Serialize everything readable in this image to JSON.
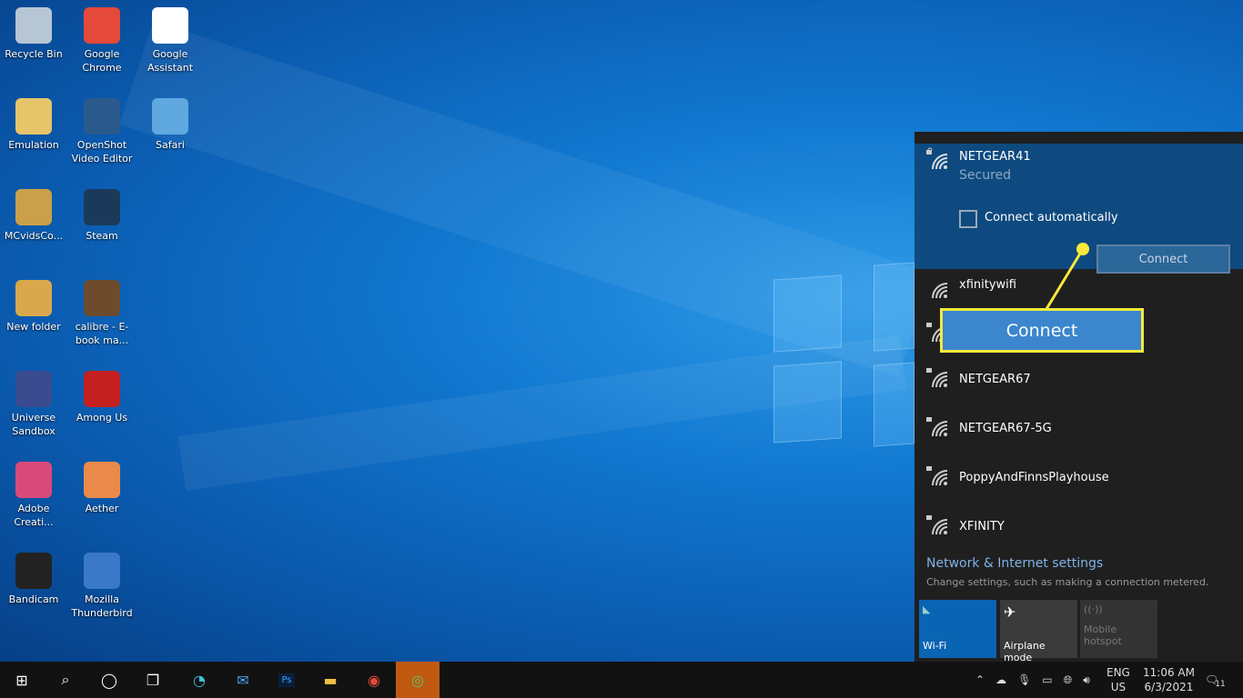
{
  "desktop_icons": [
    {
      "label": "Recycle Bin",
      "color": "#b7c6d4"
    },
    {
      "label": "Google Chrome",
      "color": "#e4493a"
    },
    {
      "label": "Google Assistant",
      "color": "#ffffff"
    },
    {
      "label": "Emulation",
      "color": "#e6c46a"
    },
    {
      "label": "OpenShot Video Editor",
      "color": "#2a5a8c"
    },
    {
      "label": "Safari",
      "color": "#5fa8e0"
    },
    {
      "label": "MCvidsCo...",
      "color": "#caa04a"
    },
    {
      "label": "Steam",
      "color": "#1b3a5a"
    },
    {
      "label": "New folder",
      "color": "#d9a84c"
    },
    {
      "label": "calibre - E-book ma...",
      "color": "#6d4c2e"
    },
    {
      "label": "Universe Sandbox",
      "color": "#3b4b8f"
    },
    {
      "label": "Among Us",
      "color": "#c42020"
    },
    {
      "label": "Adobe Creati...",
      "color": "#d84a7a"
    },
    {
      "label": "Aether",
      "color": "#e98a4a"
    },
    {
      "label": "Bandicam",
      "color": "#222222"
    },
    {
      "label": "Mozilla Thunderbird",
      "color": "#3a78c8"
    }
  ],
  "network_panel": {
    "selected": {
      "name": "NETGEAR41",
      "status": "Secured",
      "auto_label": "Connect automatically",
      "auto_checked": false,
      "connect_label": "Connect"
    },
    "networks": [
      {
        "name": "xfinitywifi",
        "secured": false
      },
      {
        "name": "",
        "secured": true
      },
      {
        "name": "NETGEAR67",
        "secured": true
      },
      {
        "name": "NETGEAR67-5G",
        "secured": true
      },
      {
        "name": "PoppyAndFinnsPlayhouse",
        "secured": true
      },
      {
        "name": "XFINITY",
        "secured": true
      }
    ],
    "settings_link": "Network & Internet settings",
    "settings_desc": "Change settings, such as making a connection metered.",
    "tiles": [
      {
        "label": "Wi-Fi",
        "icon": "wifi-icon",
        "active": true
      },
      {
        "label": "Airplane mode",
        "icon": "airplane-icon",
        "active": false
      },
      {
        "label": "Mobile hotspot",
        "icon": "hotspot-icon",
        "active": false,
        "disabled": true
      }
    ]
  },
  "callout": {
    "label": "Connect",
    "color": "#f7e93b"
  },
  "taskbar": {
    "apps": [
      "start-icon",
      "search-icon",
      "cortana-icon",
      "task-view-icon",
      "edge-icon",
      "mail-icon",
      "photoshop-icon",
      "file-explorer-icon",
      "chrome-icon",
      "browser-icon"
    ],
    "lang_top": "ENG",
    "lang_bottom": "US",
    "time": "11:06 AM",
    "date": "6/3/2021",
    "notifications": "11"
  }
}
